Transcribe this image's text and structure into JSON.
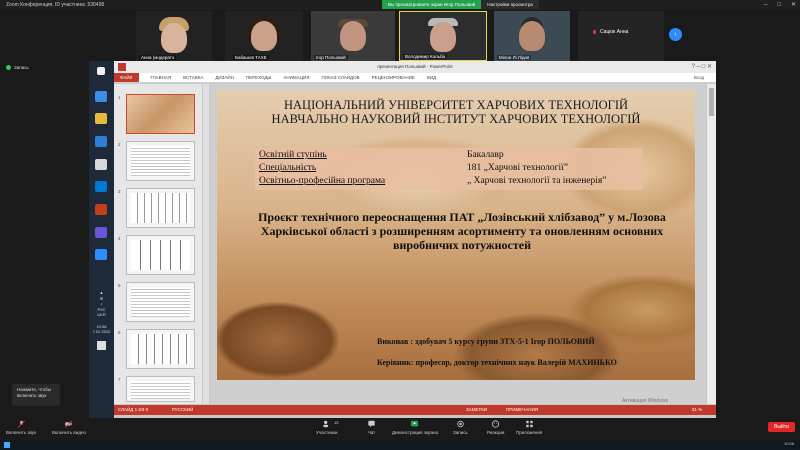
{
  "zoom": {
    "window_title": "Zoom Конференция, ID участника: 530498",
    "share_banner_notice": "Вы просматриваете экран Игор Польовий",
    "share_banner_options": "Настройки просмотра",
    "participants": [
      {
        "name": "Анна (модерато"
      },
      {
        "name": "Бабашов ТАХЕ"
      },
      {
        "name": "Ігор Польовий"
      },
      {
        "name": "Володимир Кольба"
      },
      {
        "name": "Мілон Лі Лідня"
      },
      {
        "name": "Сацюк Анна"
      }
    ],
    "recording_label": "Запись",
    "controls": [
      {
        "label": "Включить звук",
        "icon": "mic-icon"
      },
      {
        "label": "Включить видео",
        "icon": "video-icon"
      },
      {
        "label": "Участники",
        "icon": "participants-icon",
        "count": "15"
      },
      {
        "label": "Чат",
        "icon": "chat-icon"
      },
      {
        "label": "Демонстрация экрана",
        "icon": "share-screen-icon"
      },
      {
        "label": "Запись",
        "icon": "record-icon"
      },
      {
        "label": "Реакции",
        "icon": "reaction-icon"
      },
      {
        "label": "Приложения",
        "icon": "apps-icon"
      }
    ],
    "end_label": "Выйти",
    "tooltip_lines": [
      "Нажмите, чтобы",
      "включить звук"
    ]
  },
  "powerpoint": {
    "title": "презентация Польовий - PowerPoint",
    "ribbon_tabs": [
      "ФАЙЛ",
      "ГЛАВНАЯ",
      "ВСТАВКА",
      "ДИЗАЙН",
      "ПЕРЕХОДЫ",
      "АНИМАЦИЯ",
      "ПОКАЗ СЛАЙДОВ",
      "РЕЦЕНЗИРОВАНИЕ",
      "ВИД"
    ],
    "user": "Вход",
    "thumb_numbers": [
      "1",
      "2",
      "3",
      "4",
      "5",
      "6",
      "7"
    ],
    "status_slide": "СЛАЙД 1 ИЗ 9",
    "status_lang": "РУССКИЙ",
    "status_notes": "ЗАМЕТКИ",
    "status_comments": "ПРИМЕЧАНИЯ",
    "zoom_level": "61 %",
    "activate_windows": "Активация Windows",
    "activate_windows_hint": "Чтобы активировать Windows, перейдите в раздел \"Параметры\"."
  },
  "slide": {
    "heading1": "НАЦІОНАЛЬНИЙ УНІВЕРСИТЕТ ХАРЧОВИХ ТЕХНОЛОГІЙ",
    "heading2": "НАВЧАЛЬНО НАУКОВИЙ ІНСТИТУТ ХАРЧОВИХ ТЕХНОЛОГІЙ",
    "info": [
      {
        "key": "Освітній ступінь",
        "value": "Бакалавр"
      },
      {
        "key": "Спеціальність",
        "value": "181 „Харчові технології”"
      },
      {
        "key": "Освітньо-професійна програма",
        "value": "„ Харчові технології та інженерія”"
      }
    ],
    "project_title": "Проєкт технічного переоснащення ПАТ „Лозівський хлібзавод” у м.Лозова Харківської області з розширенням асортименту та оновленням основних виробничих потужностей",
    "author_label": "Виконав :",
    "author_text": "здобувач 5 курсу групи ЗТХ-5-1 Ігор ПОЛЬОВИЙ",
    "supervisor_label": "Керівник:",
    "supervisor_text": "професор, доктор технічних наук Валерій МАХИНЬКО"
  },
  "windows": {
    "tray_lang": "РУС",
    "tray_lang2": "UKR",
    "tray_time": "10:06",
    "tray_date": "7.02.2022",
    "clock": "10:06"
  },
  "colors": {
    "accent_red": "#c0392b",
    "zoom_blue": "#2d8cff",
    "end_red": "#e02828",
    "share_green": "#23a24d"
  }
}
